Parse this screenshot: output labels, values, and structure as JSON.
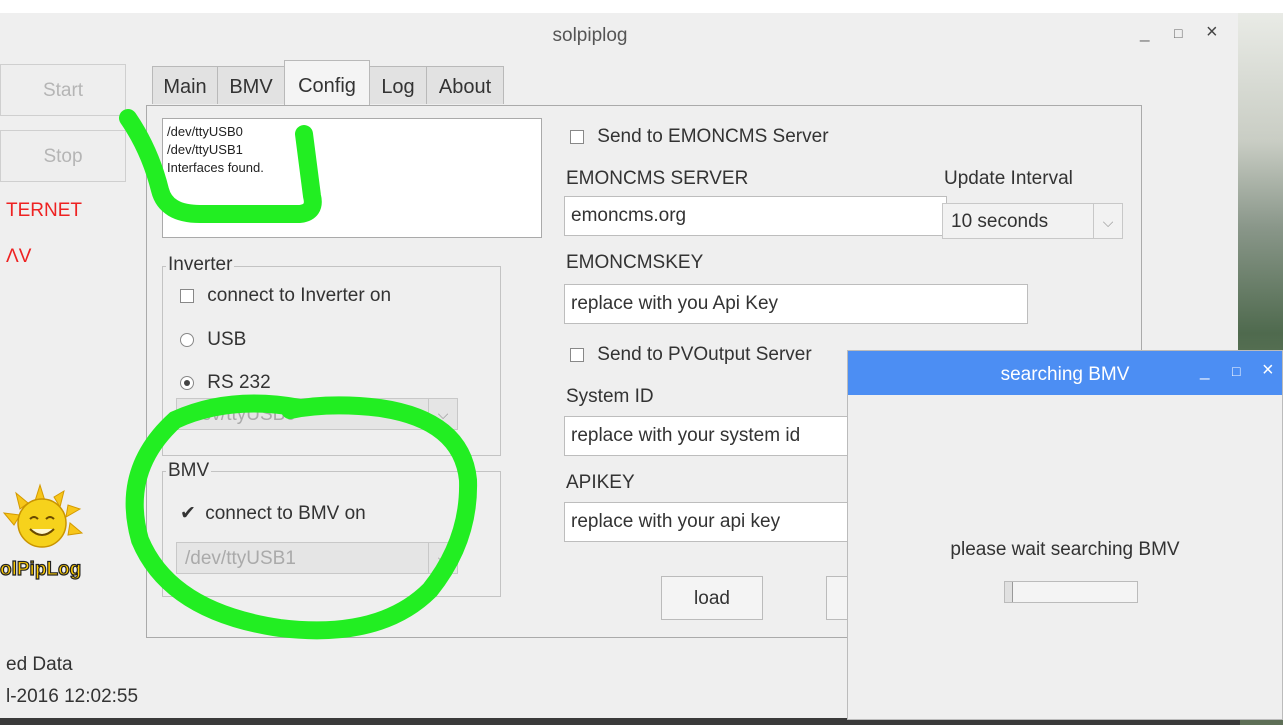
{
  "window": {
    "title": "solpiplog",
    "controls": {
      "minimize": "_",
      "maximize": "□",
      "close": "×"
    }
  },
  "left": {
    "start_label": "Start",
    "stop_label": "Stop",
    "status_internet": "TERNET",
    "status_bmv": "ΛV",
    "logo_text": "olPipLog",
    "footer_line1": "ed Data",
    "footer_line2": "l-2016 12:02:55"
  },
  "tabs": [
    {
      "label": "Main"
    },
    {
      "label": "BMV"
    },
    {
      "label": "Config"
    },
    {
      "label": "Log"
    },
    {
      "label": "About"
    }
  ],
  "config": {
    "interfaces_log": [
      "/dev/ttyUSB0",
      "/dev/ttyUSB1",
      "Interfaces found."
    ],
    "inverter": {
      "group_title": "Inverter",
      "connect_label": "connect to Inverter on",
      "usb_label": "USB",
      "rs232_label": "RS 232",
      "port_value": "/dev/ttyUSB0"
    },
    "bmv": {
      "group_title": "BMV",
      "connect_label": "connect to BMV on",
      "port_value": "/dev/ttyUSB1"
    },
    "emoncms": {
      "send_label": "Send to EMONCMS Server",
      "server_label": "EMONCMS SERVER",
      "server_value": "emoncms.org",
      "interval_label": "Update Interval",
      "interval_value": "10 seconds",
      "key_label": "EMONCMSKEY",
      "key_value": "replace with you Api Key"
    },
    "pvoutput": {
      "send_label": "Send to PVOutput Server",
      "system_id_label": "System ID",
      "system_id_value": "replace with your system id",
      "apikey_label": "APIKEY",
      "apikey_value": "replace with your api key"
    },
    "load_label": "load"
  },
  "dialog": {
    "title": "searching BMV",
    "message": "please wait searching BMV",
    "progress": 0.05,
    "controls": {
      "minimize": "_",
      "maximize": "□",
      "close": "×"
    }
  },
  "colors": {
    "accent": "#4c8ef3",
    "highlight_green": "#22ee22",
    "status_red": "#ee2222"
  }
}
